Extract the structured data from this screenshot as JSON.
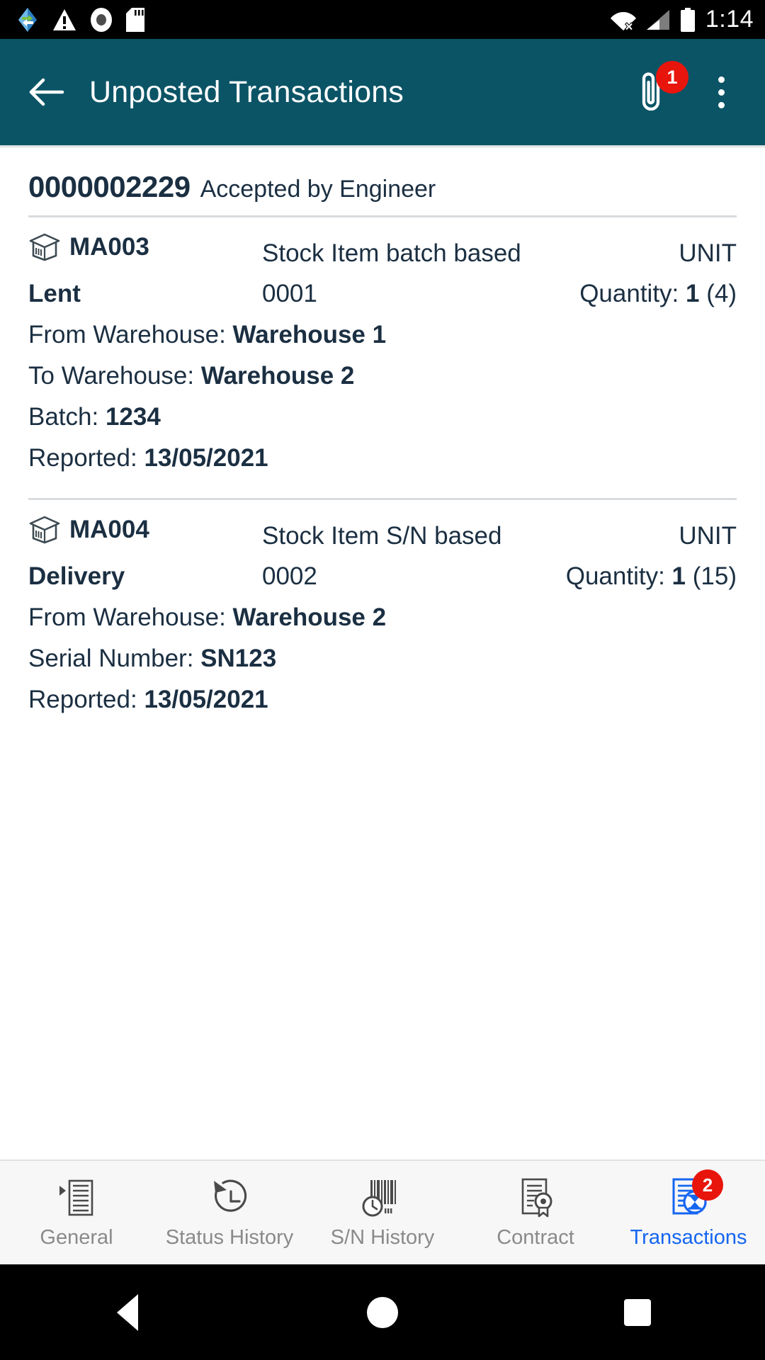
{
  "statusbar": {
    "icons_left": [
      "sync-icon",
      "warning-icon",
      "record-icon",
      "sd-card-icon"
    ],
    "icons_right": [
      "wifi-off-icon",
      "signal-icon",
      "battery-icon"
    ],
    "time": "1:14"
  },
  "appbar": {
    "back_icon": "back-arrow-icon",
    "title": "Unposted Transactions",
    "attachment_icon": "paperclip-icon",
    "attachment_badge": "1",
    "overflow_icon": "more-vertical-icon",
    "background_color": "#0b5466"
  },
  "document": {
    "number": "0000002229",
    "status": "Accepted by Engineer"
  },
  "transactions": [
    {
      "item_icon": "package-box-icon",
      "code": "MA003",
      "description": "Stock Item batch based",
      "unit": "UNIT",
      "type": "Lent",
      "line_no": "0001",
      "quantity_label": "Quantity:",
      "quantity_value": "1",
      "quantity_total": "(4)",
      "details": [
        {
          "label": "From Warehouse:",
          "value": "Warehouse 1"
        },
        {
          "label": "To Warehouse:",
          "value": "Warehouse 2"
        },
        {
          "label": "Batch:",
          "value": "1234"
        },
        {
          "label": "Reported:",
          "value": "13/05/2021"
        }
      ]
    },
    {
      "item_icon": "package-box-icon",
      "code": "MA004",
      "description": "Stock Item S/N based",
      "unit": "UNIT",
      "type": "Delivery",
      "line_no": "0002",
      "quantity_label": "Quantity:",
      "quantity_value": "1",
      "quantity_total": "(15)",
      "details": [
        {
          "label": "From Warehouse:",
          "value": "Warehouse 2"
        },
        {
          "label": "Serial Number:",
          "value": "SN123"
        },
        {
          "label": "Reported:",
          "value": "13/05/2021"
        }
      ]
    }
  ],
  "tabbar": {
    "active_color": "#1565f0",
    "inactive_color": "#8a8a8a",
    "items": [
      {
        "label": "General",
        "icon": "document-general-icon",
        "active": false,
        "badge": ""
      },
      {
        "label": "Status History",
        "icon": "clock-rotate-icon",
        "active": false,
        "badge": ""
      },
      {
        "label": "S/N History",
        "icon": "barcode-clock-icon",
        "active": false,
        "badge": ""
      },
      {
        "label": "Contract",
        "icon": "contract-seal-icon",
        "active": false,
        "badge": ""
      },
      {
        "label": "Transactions",
        "icon": "document-hourglass-icon",
        "active": true,
        "badge": "2"
      }
    ]
  },
  "navbar": {
    "back": "nav-back-icon",
    "home": "nav-home-icon",
    "recents": "nav-recents-icon"
  }
}
